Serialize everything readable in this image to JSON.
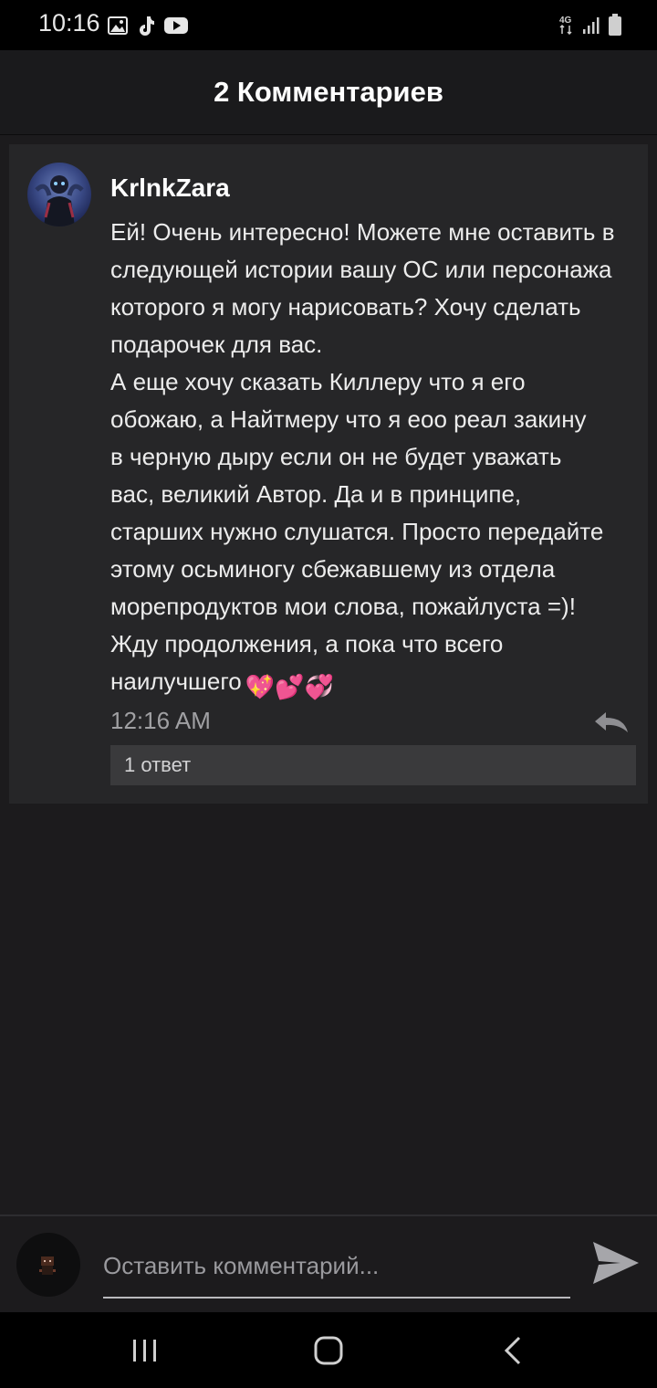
{
  "status_bar": {
    "time": "10:16",
    "network": "4G",
    "icons_left": [
      "image-icon",
      "tiktok-icon",
      "youtube-icon"
    ],
    "icons_right": [
      "network-4g-icon",
      "signal-icon",
      "battery-icon"
    ]
  },
  "header": {
    "title": "2 Комментариев"
  },
  "comment": {
    "username": "KrlnkZara",
    "lines": [
      "Ей! Очень интересно! Можете мне оставить в",
      "следующей истории вашу ОС или персонажа",
      "которого я могу нарисовать? Хочу сделать",
      "подарочек для вас.",
      "А еще хочу сказать Киллеру что я его",
      "обожаю, а Найтмеру что я еоо реал закину",
      "в черную дыру если он не будет уважать",
      "вас, великий Автор. Да и в принципе,",
      "старших нужно слушатся. Просто передайте",
      "этому осьминогу сбежавшему из отдела",
      "морепродуктов мои слова, пожайлуста =)!",
      "Жду продолжения, а пока что всего",
      "наилучшего"
    ],
    "emojis": "💖💕💞",
    "time": "12:16 AM",
    "replies_label": "1 ответ"
  },
  "input": {
    "placeholder": "Оставить комментарий..."
  },
  "colors": {
    "background": "#1c1b1d",
    "card": "#262628",
    "replies_bar": "#3a3a3c",
    "muted_text": "#a0a0a3"
  }
}
